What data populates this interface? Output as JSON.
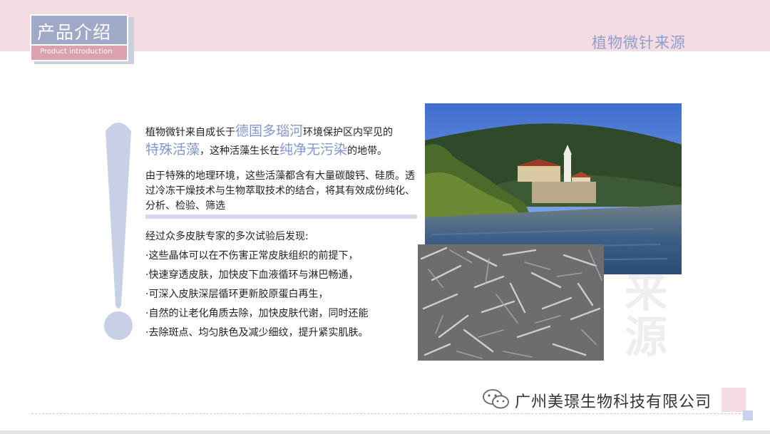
{
  "header": {
    "title": "产品介绍",
    "subtitle": "Product introduction",
    "section_title": "植物微针来源"
  },
  "intro": {
    "p1_a": "植物微针来自成长于",
    "p1_hl1": "德国多瑙河",
    "p1_b": "环境保护区内罕见的",
    "p1_hl2": "特殊活藻",
    "p1_c": "，这种活藻生长在",
    "p1_hl3": "纯净无污染",
    "p1_d": "的地带。",
    "p2": "由于特殊的地理环境，这些活藻都含有大量碳酸钙、硅质。透过冷冻干燥技术与生物萃取技术的结合，将其有效成份纯化、分析、检验、筛选"
  },
  "findings": {
    "lead": "经过众多皮肤专家的多次试验后发现:",
    "items": [
      "·这些晶体可以在不伤害正常皮肤组织的前提下，",
      "·快速穿透皮肤，加快皮下血液循环与淋巴畅通，",
      "·可深入皮肤深层循环更新胶原蛋白再生，",
      "·自然的让老化角质去除，加快皮肤代谢，同时还能",
      "·去除斑点、均匀肤色及减少细纹，提升紧实肌肤。"
    ]
  },
  "watermark": {
    "c1": "来",
    "c2": "源"
  },
  "footer": {
    "company": "广州美璟生物科技有限公司"
  },
  "icons": {
    "exclamation": "exclamation-mark",
    "wechat": "wechat-icon"
  },
  "colors": {
    "accent_blue": "#8397cf",
    "title_bar": "#9fa9c8",
    "pink_band": "#f2dce2",
    "sub_bar": "#dba1ae"
  }
}
